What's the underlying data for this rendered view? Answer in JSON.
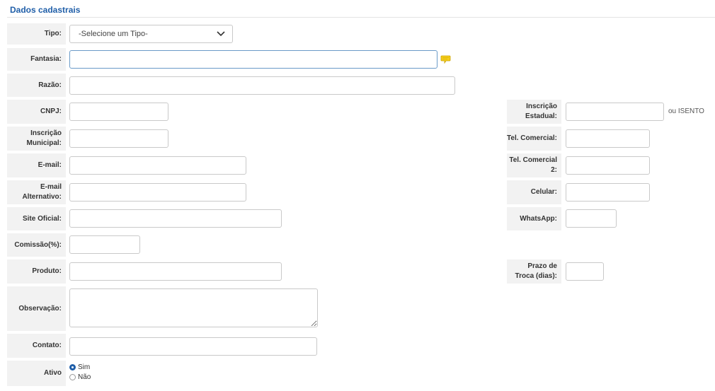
{
  "section": {
    "title": "Dados cadastrais"
  },
  "fields": {
    "tipo": {
      "label": "Tipo:",
      "selected": "-Selecione um Tipo-"
    },
    "fantasia": {
      "label": "Fantasia:",
      "value": ""
    },
    "razao": {
      "label": "Razão:",
      "value": ""
    },
    "cnpj": {
      "label": "CNPJ:",
      "value": ""
    },
    "inscricao_estadual": {
      "label": "Inscrição Estadual:",
      "value": "",
      "suffix": "ou ISENTO"
    },
    "inscricao_municipal": {
      "label": "Inscrição Municipal:",
      "value": ""
    },
    "tel_comercial": {
      "label": "Tel. Comercial:",
      "value": ""
    },
    "email": {
      "label": "E-mail:",
      "value": ""
    },
    "tel_comercial2": {
      "label": "Tel. Comercial 2:",
      "value": ""
    },
    "email_alt": {
      "label": "E-mail Alternativo:",
      "value": ""
    },
    "celular": {
      "label": "Celular:",
      "value": ""
    },
    "site": {
      "label": "Site Oficial:",
      "value": ""
    },
    "whatsapp": {
      "label": "WhatsApp:",
      "value": ""
    },
    "comissao": {
      "label": "Comissão(%):",
      "value": ""
    },
    "produto": {
      "label": "Produto:",
      "value": ""
    },
    "prazo_troca": {
      "label": "Prazo de Troca (dias):",
      "value": ""
    },
    "observacao": {
      "label": "Observação:",
      "value": ""
    },
    "contato": {
      "label": "Contato:",
      "value": ""
    },
    "ativo": {
      "label": "Ativo",
      "options": [
        "Sim",
        "Não"
      ],
      "selected": "Sim"
    }
  },
  "colors": {
    "accent": "#1f5ea8",
    "hint_icon": "#f2c200"
  },
  "icons": {
    "select_arrow": "chevron-down-icon",
    "hint": "speech-bubble-icon"
  }
}
